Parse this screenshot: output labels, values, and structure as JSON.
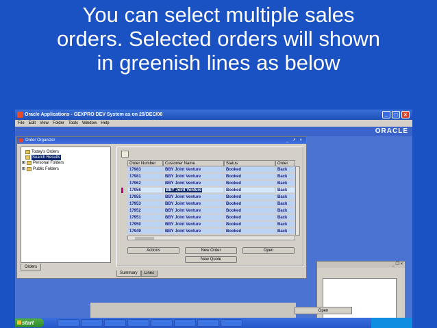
{
  "slide": {
    "title_lines": [
      "You can select multiple sales",
      "orders. Selected orders will shown",
      "in greenish lines as below"
    ]
  },
  "window": {
    "title": "Oracle Applications - GEXPRO DEV System as on 25/DEC/08",
    "brand": "ORACLE",
    "menu": [
      "File",
      "Edit",
      "View",
      "Folder",
      "Tools",
      "Window",
      "Help"
    ],
    "help_glyph": "?"
  },
  "organizer": {
    "title": "Order Organizer",
    "tree": [
      "Today's Orders",
      "Search Results",
      "Personal Folders",
      "Public Folders"
    ],
    "selected_tree_item": "Search Results",
    "orders_tab": "Orders"
  },
  "grid": {
    "columns": [
      "Order Number",
      "Customer Name",
      "Status",
      "Order"
    ],
    "rows": [
      [
        "17983",
        "BBY Joint Venture",
        "Booked",
        "Back"
      ],
      [
        "17981",
        "BBY Joint Venture",
        "Booked",
        "Back"
      ],
      [
        "17962",
        "BBY Joint Venture",
        "Booked",
        "Back"
      ],
      [
        "17956",
        "BBY Joint Venture",
        "Booked",
        "Back"
      ],
      [
        "17955",
        "BBY Joint Venture",
        "Booked",
        "Back"
      ],
      [
        "17953",
        "BBY Joint Venture",
        "Booked",
        "Back"
      ],
      [
        "17952",
        "BBY Joint Venture",
        "Booked",
        "Back"
      ],
      [
        "17951",
        "BBY Joint Venture",
        "Booked",
        "Back"
      ],
      [
        "17950",
        "BBY Joint Venture",
        "Booked",
        "Back"
      ],
      [
        "17949",
        "BBY Joint Venture",
        "Booked",
        "Back"
      ]
    ],
    "current_row": 3
  },
  "buttons": {
    "actions": "Actions",
    "new_order": "New Order",
    "open": "Open",
    "new_quote": "New Quote",
    "open_back": "Open"
  },
  "tabs": [
    "Summary",
    "Lines"
  ]
}
